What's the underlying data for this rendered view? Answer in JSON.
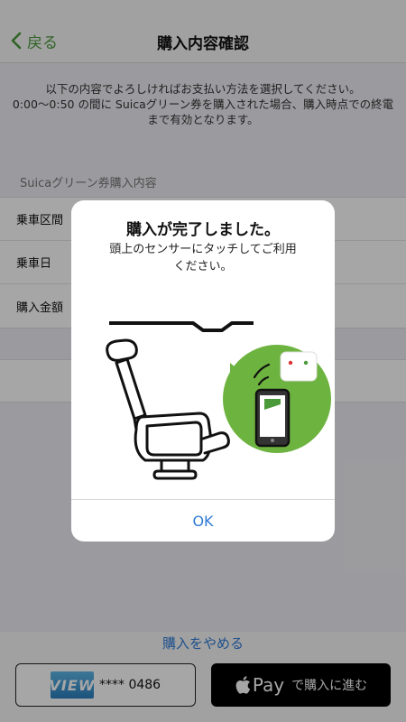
{
  "header": {
    "back_label": "戻る",
    "title": "購入内容確認"
  },
  "intro": {
    "line1": "以下の内容でよろしければお支払い方法を選択してください。",
    "line2": "0:00〜0:50 の間に Suicaグリーン券を購入された場合、購入時点での終電",
    "line3": "まで有効となります。"
  },
  "section": {
    "label": "Suicaグリーン券購入内容",
    "rows": [
      {
        "label": "乗車区間"
      },
      {
        "label": "乗車日"
      },
      {
        "label": "購入金額"
      }
    ]
  },
  "footer": {
    "cancel_label": "購入をやめる",
    "card_logo": "VIEW",
    "card_number": "**** 0486",
    "apple_pay_word": "Pay",
    "apple_pay_label": "で購入に進む"
  },
  "dialog": {
    "title": "購入が完了しました。",
    "message_line1": "頭上のセンサーにタッチしてご利用",
    "message_line2": "ください。",
    "ok_label": "OK"
  },
  "colors": {
    "accent_green": "#4a9a3a",
    "link_blue": "#2f7bd6",
    "illustration_green": "#6db33f"
  }
}
